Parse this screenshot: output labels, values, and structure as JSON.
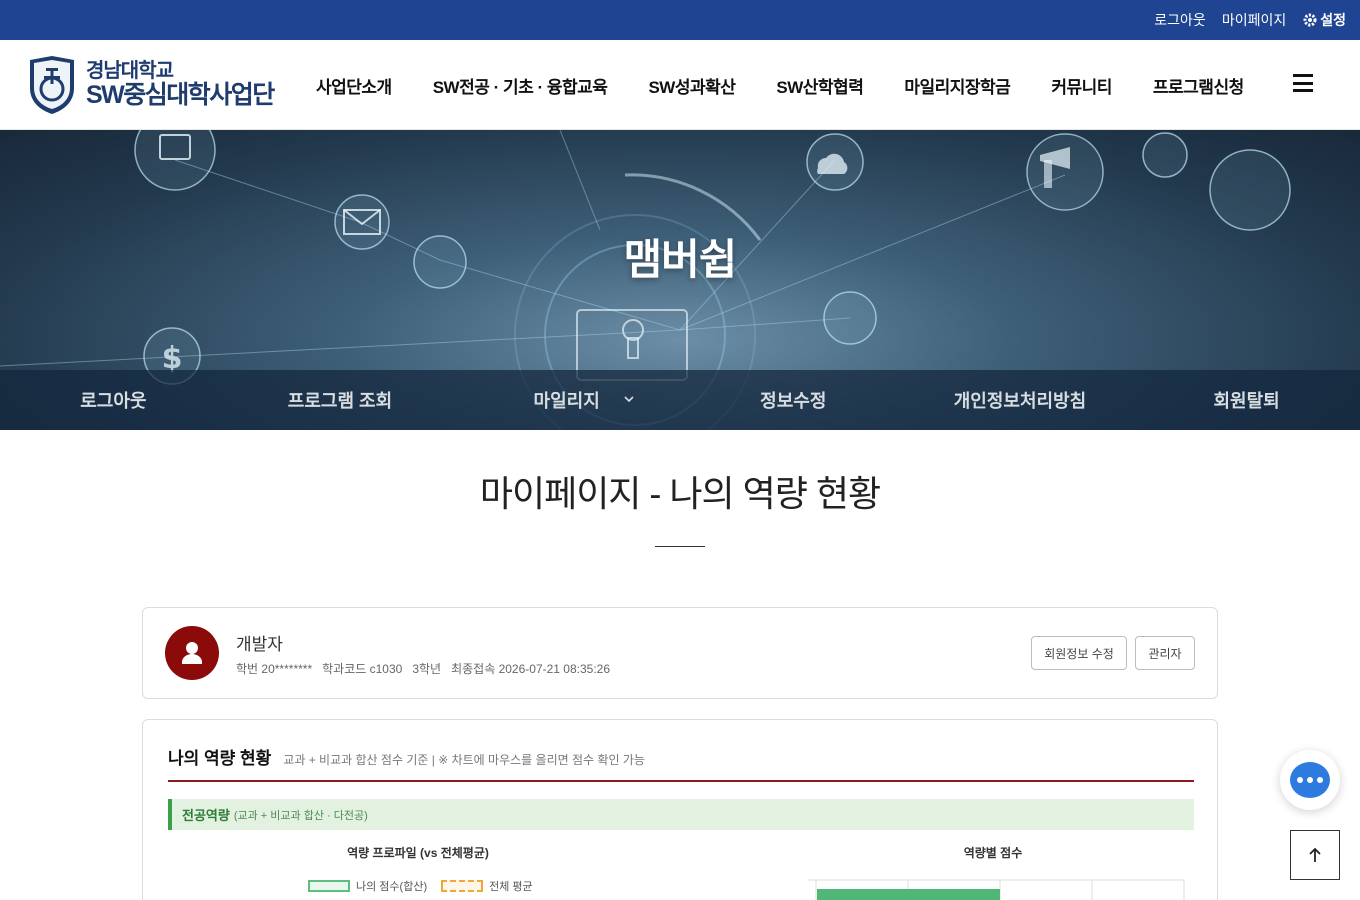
{
  "topbar": {
    "logout": "로그아웃",
    "mypage": "마이페이지",
    "settings": "설정",
    "settings_icon": "gear-icon"
  },
  "logo": {
    "line1": "경남대학교",
    "line2": "SW중심대학사업단"
  },
  "gnb": {
    "items": [
      "사업단소개",
      "SW전공 · 기초 · 융합교육",
      "SW성과확산",
      "SW산학협력",
      "마일리지장학금",
      "커뮤니티",
      "프로그램신청"
    ],
    "menu_icon": "hamburger-icon"
  },
  "hero": {
    "title": "맴버쉽"
  },
  "subnav": {
    "items": [
      "로그아웃",
      "프로그램 조회",
      "마일리지",
      "정보수정",
      "개인정보처리방침",
      "회원탈퇴"
    ]
  },
  "page": {
    "title": "마이페이지 - 나의 역량 현황"
  },
  "profile": {
    "name": "개발자",
    "student_id": "학번 20********",
    "dept_code": "학과코드 c1030",
    "grade": "3학년",
    "last_login": "최종접속 2026-07-21 08:35:26",
    "edit_button": "회원정보 수정",
    "admin_button": "관리자"
  },
  "competency": {
    "heading": "나의 역량 현황",
    "note": "교과 + 비교과 합산 점수 기준  |  ※ 차트에 마우스를 올리면 점수 확인 가능",
    "section_title": "전공역량",
    "section_note": "(교과 + 비교과 합산 · 다전공)",
    "chart1_title": "역량 프로파일 (vs 전체평균)",
    "chart2_title": "역량별 점수",
    "legend_mine": "나의 점수(합산)",
    "legend_avg": "전체 평균"
  },
  "colors": {
    "topbar": "#1f4491",
    "brand_navy": "#1e3c6e",
    "accent_red": "#8b1a1a",
    "green": "#3aa04a",
    "chat_blue": "#2e7be0"
  }
}
